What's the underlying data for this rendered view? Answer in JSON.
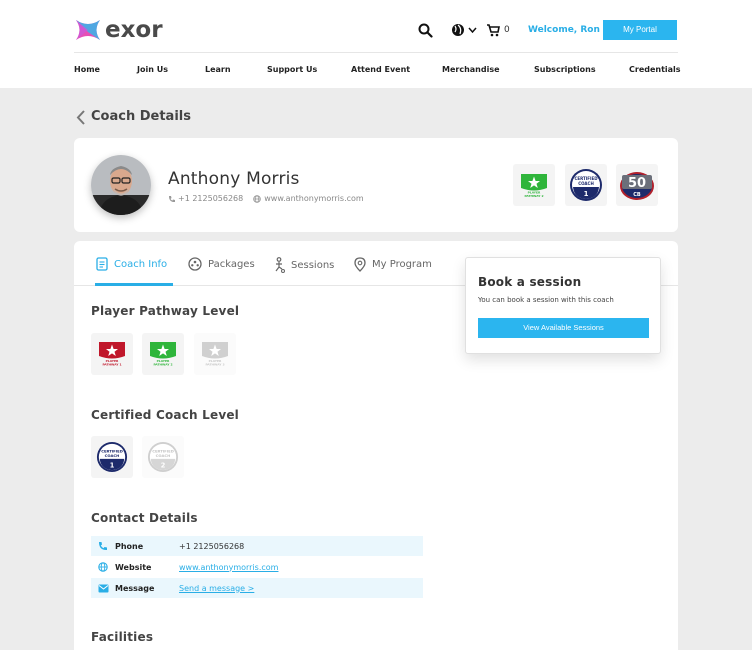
{
  "brand": {
    "name": "exor"
  },
  "header": {
    "cart_count": "0",
    "welcome": "Welcome, Ron",
    "portal_label": "My Portal",
    "nav": [
      "Home",
      "Join Us",
      "Learn",
      "Support Us",
      "Attend Event",
      "Merchandise",
      "Subscriptions",
      "Credentials"
    ]
  },
  "page": {
    "title": "Coach Details"
  },
  "profile": {
    "name": "Anthony Morris",
    "phone": "+1 2125056268",
    "website": "www.anthonymorris.com",
    "badges": [
      {
        "icon": "player-pathway-2-badge",
        "lines": [
          "PLAYER",
          "PATHWAY 2"
        ]
      },
      {
        "icon": "certified-coach-1-badge",
        "lines": [
          "CERTIFIED",
          "COACH",
          "1"
        ]
      },
      {
        "icon": "cb-50-badge",
        "lines": [
          "50",
          "CB"
        ]
      }
    ]
  },
  "tabs": [
    {
      "label": "Coach Info",
      "icon": "document-icon",
      "active": true
    },
    {
      "label": "Packages",
      "icon": "ball-icon",
      "active": false
    },
    {
      "label": "Sessions",
      "icon": "player-icon",
      "active": false
    },
    {
      "label": "My Program",
      "icon": "location-pin-icon",
      "active": false
    }
  ],
  "sections": {
    "pathway_title": "Player Pathway Level",
    "pathway_levels": [
      {
        "lines": [
          "PLAYER",
          "PATHWAY 1"
        ],
        "color": "#c0172b",
        "active": true
      },
      {
        "lines": [
          "PLAYER",
          "PATHWAY 2"
        ],
        "color": "#2fb53b",
        "active": true
      },
      {
        "lines": [
          "PLAYER",
          "PATHWAY 3"
        ],
        "color": "#c8c8c8",
        "active": false
      }
    ],
    "coach_title": "Certified Coach Level",
    "coach_levels": [
      {
        "lines": [
          "CERTIFIED",
          "COACH",
          "1"
        ],
        "active": true
      },
      {
        "lines": [
          "CERTIFIED",
          "COACH",
          "2"
        ],
        "active": false
      }
    ],
    "contact_title": "Contact Details",
    "contact_rows": [
      {
        "icon": "phone-icon",
        "label": "Phone",
        "value": "+1 2125056268",
        "link": false
      },
      {
        "icon": "globe-icon",
        "label": "Website",
        "value": "www.anthonymorris.com",
        "link": true
      },
      {
        "icon": "mail-icon",
        "label": "Message",
        "value": "Send a message >",
        "link": true
      }
    ],
    "facilities_title": "Facilities"
  },
  "book": {
    "title": "Book a session",
    "subtitle": "You can book a session with this coach",
    "button": "View Available Sessions"
  },
  "colors": {
    "accent": "#2bb5ef",
    "logo_pink": "#e64fb5",
    "logo_blue": "#35b6ea"
  }
}
